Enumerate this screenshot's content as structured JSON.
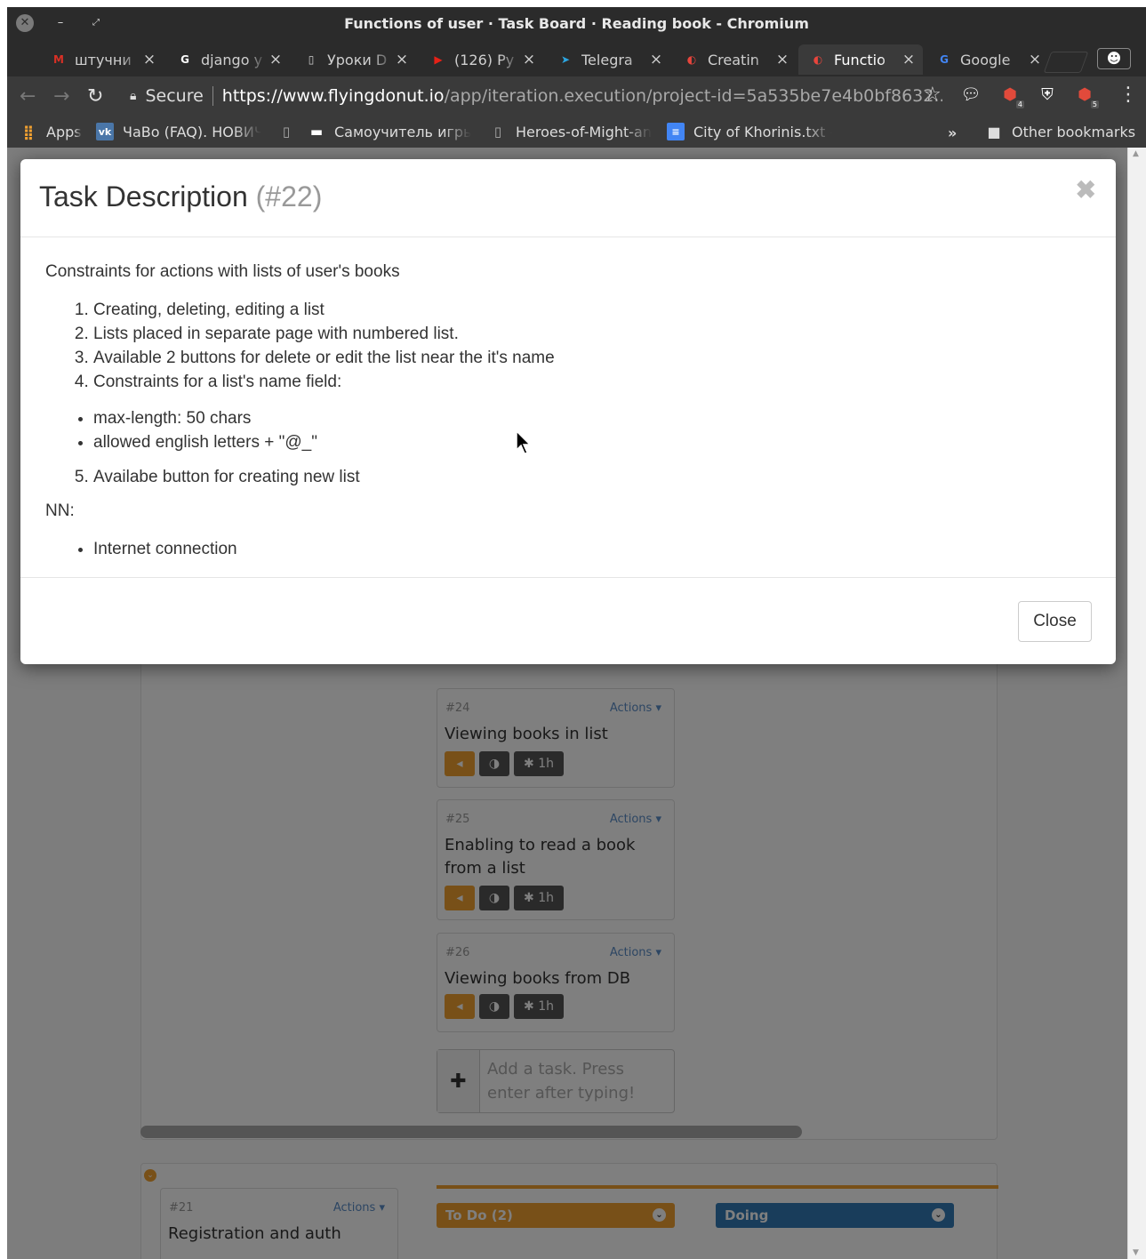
{
  "window": {
    "title": "Functions of user · Task Board · Reading book - Chromium"
  },
  "tabs": [
    {
      "label": "штучни",
      "icon": "gmail-icon",
      "color": "#d93025",
      "glyph": "M"
    },
    {
      "label": "django у",
      "icon": "google-icon",
      "color": "#ffffff",
      "glyph": "G"
    },
    {
      "label": "Уроки D",
      "icon": "page-icon",
      "color": "#cfcfcf",
      "glyph": "▯"
    },
    {
      "label": "(126) Py",
      "icon": "youtube-icon",
      "color": "#e62117",
      "glyph": "▶"
    },
    {
      "label": "Telegra",
      "icon": "telegram-icon",
      "color": "#2ca5e0",
      "glyph": "➤"
    },
    {
      "label": "Creatin",
      "icon": "flyingdonut-icon",
      "color": "#e8453c",
      "glyph": "◐"
    },
    {
      "label": "Functio",
      "icon": "flyingdonut-icon",
      "color": "#e8453c",
      "glyph": "◐"
    },
    {
      "label": "Google",
      "icon": "google-translate-icon",
      "color": "#4285f4",
      "glyph": "G"
    }
  ],
  "toolbar": {
    "secure_label": "Secure",
    "url_host": "https://www.flyingdonut.io",
    "url_path": "/app/iteration.execution/project-id=5a535be7e4b0bf8632...",
    "ext_badges": [
      "4",
      "5"
    ]
  },
  "bookmarks": [
    {
      "label": "Apps",
      "icon": "apps-grid-icon"
    },
    {
      "label": "ЧаВо (FAQ). НОВИЧ",
      "icon": "vk-icon"
    },
    {
      "label": "",
      "icon": "page-icon"
    },
    {
      "label": "Самоучитель игры",
      "icon": "keyboard-icon"
    },
    {
      "label": "Heroes-of-Might-an",
      "icon": "page-icon"
    },
    {
      "label": "City of Khorinis.txt -",
      "icon": "doc-icon"
    }
  ],
  "bookmarks_more": "»",
  "other_bookmarks": "Other bookmarks",
  "board": {
    "cards": [
      {
        "num": "#24",
        "actions": "Actions",
        "title": "Viewing books in list",
        "estimate": "1h"
      },
      {
        "num": "#25",
        "actions": "Actions",
        "title": "Enabling to read a book from a list",
        "estimate": "1h"
      },
      {
        "num": "#26",
        "actions": "Actions",
        "title": "Viewing books from DB",
        "estimate": "1h"
      }
    ],
    "add_task_placeholder": "Add a task. Press enter after typing!",
    "bottom_card": {
      "num": "#21",
      "actions": "Actions",
      "title": "Registration and auth"
    },
    "columns": [
      {
        "label": "To Do (2)",
        "color": "#f0a030"
      },
      {
        "label": "Doing",
        "color": "#337ab7"
      }
    ]
  },
  "modal": {
    "title": "Task Description",
    "title_num": "(#22)",
    "intro": "Constraints for actions with lists of user's books",
    "list1": [
      "Creating, deleting, editing a list",
      "Lists placed in separate page with numbered list.",
      "Available 2 buttons for delete or edit the list near the it's name",
      "Constraints for a list's name field:"
    ],
    "bullets1": [
      "max-length: 50 chars",
      "allowed english letters + \"@_\""
    ],
    "list2": [
      "Availabe button for creating new list"
    ],
    "nn_label": "NN:",
    "bullets2": [
      "Internet connection"
    ],
    "close_label": "Close",
    "close_x": "✖"
  }
}
